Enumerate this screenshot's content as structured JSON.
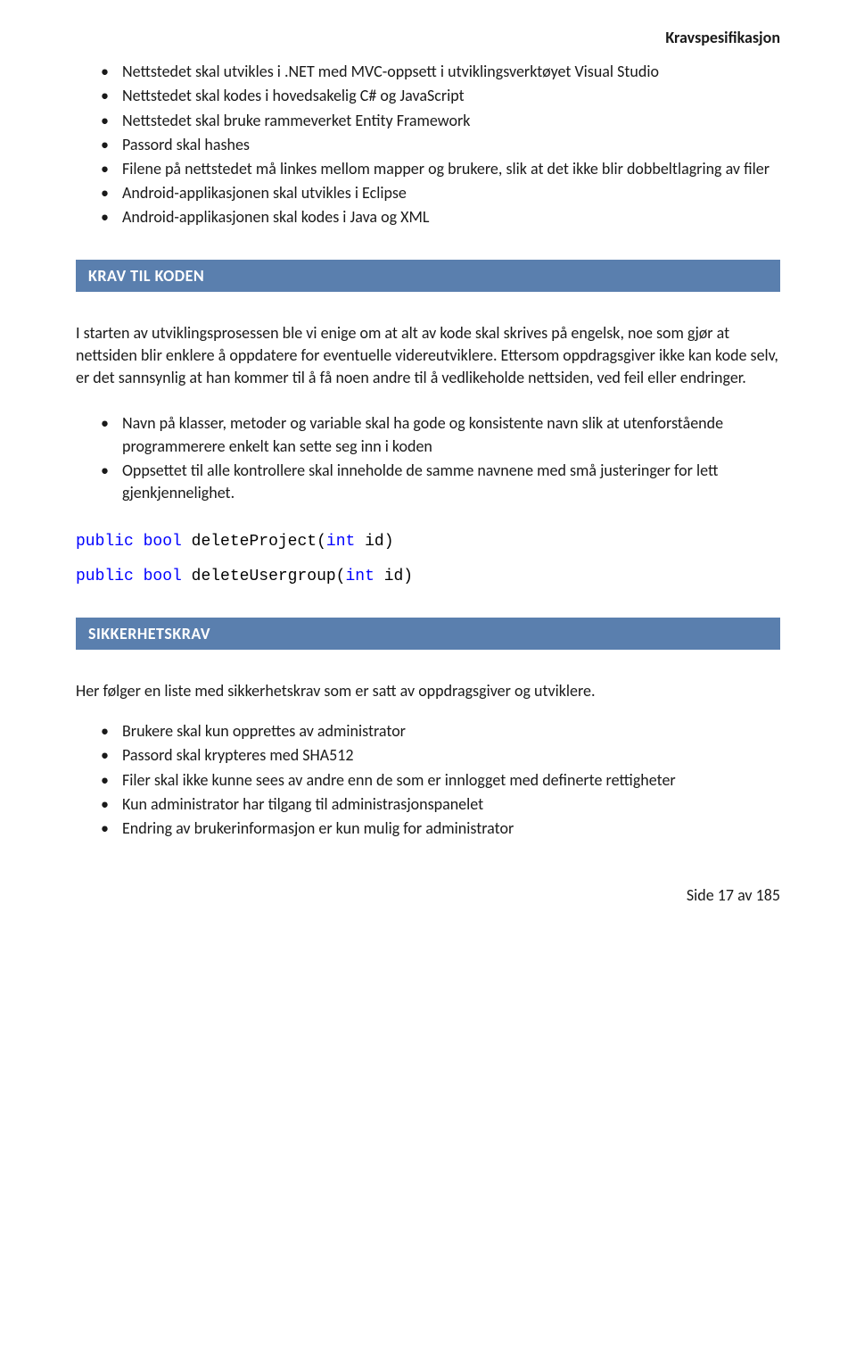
{
  "header": {
    "title": "Kravspesifikasjon"
  },
  "list1": {
    "items": [
      "Nettstedet skal utvikles i .NET med MVC-oppsett i utviklingsverktøyet Visual Studio",
      "Nettstedet skal kodes i hovedsakelig C# og JavaScript",
      "Nettstedet skal bruke rammeverket Entity Framework",
      "Passord skal hashes",
      "Filene på nettstedet må linkes mellom mapper og brukere, slik at det ikke blir dobbeltlagring av filer",
      "Android-applikasjonen skal utvikles i Eclipse",
      "Android-applikasjonen skal kodes i Java og XML"
    ]
  },
  "section1": {
    "title": "KRAV TIL KODEN"
  },
  "para1": "I starten av utviklingsprosessen ble vi enige om at alt av kode skal skrives på engelsk, noe som gjør at nettsiden blir enklere å oppdatere for eventuelle videreutviklere. Ettersom oppdragsgiver ikke kan kode selv, er det sannsynlig at han kommer til å få noen andre til å vedlikeholde nettsiden, ved feil eller endringer.",
  "list2": {
    "items": [
      "Navn på klasser, metoder og variable skal ha gode og konsistente navn slik at utenforstående programmerere enkelt kan sette seg inn i koden",
      "Oppsettet til alle kontrollere skal inneholde de samme navnene med små justeringer for lett gjenkjennelighet."
    ]
  },
  "code1": {
    "kw1": "public",
    "kw2": "bool",
    "fn": "deleteProject(",
    "type": "int",
    "rest": " id)"
  },
  "code2": {
    "kw1": "public",
    "kw2": "bool",
    "fn": "deleteUsergroup(",
    "type": "int",
    "rest": " id)"
  },
  "section2": {
    "title": "SIKKERHETSKRAV"
  },
  "para2": "Her følger en liste med sikkerhetskrav som er satt av oppdragsgiver og utviklere.",
  "list3": {
    "items": [
      "Brukere skal kun opprettes av administrator",
      "Passord skal krypteres med SHA512",
      "Filer skal ikke kunne sees av andre enn de som er innlogget med definerte rettigheter",
      "Kun administrator har tilgang til administrasjonspanelet",
      "Endring av brukerinformasjon er kun mulig for administrator"
    ]
  },
  "footer": {
    "text": "Side 17 av 185"
  }
}
